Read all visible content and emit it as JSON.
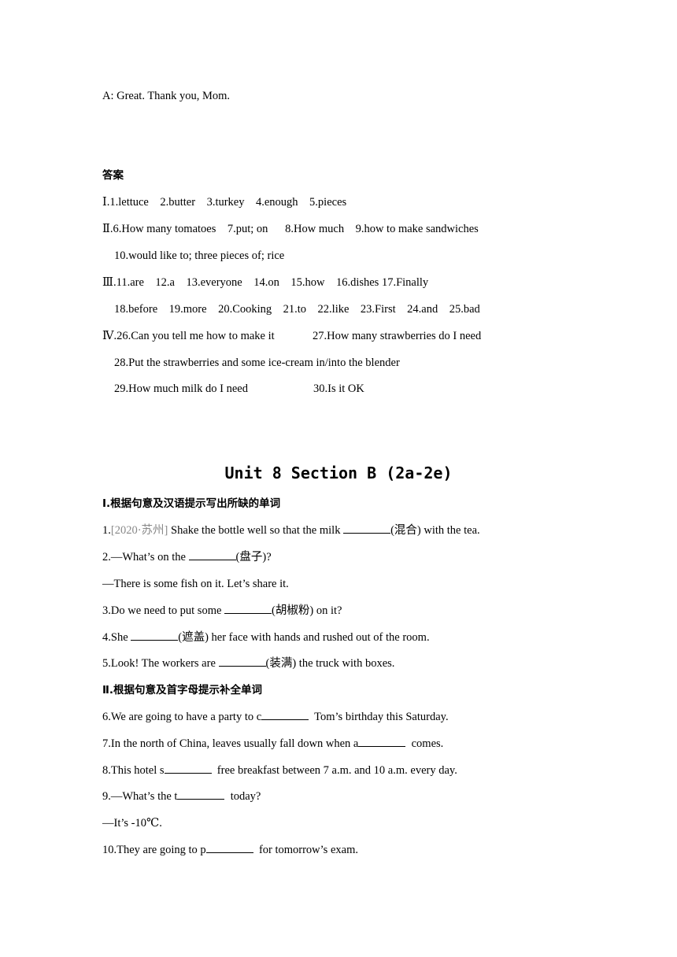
{
  "dialogue_end": "A: Great. Thank you, Mom.",
  "answers": {
    "heading": "答案",
    "part1": "Ⅰ.1.lettuce    2.butter    3.turkey    4.enough    5.pieces",
    "part2_line1": "Ⅱ.6.How many tomatoes    7.put; on      8.How much    9.how to make sandwiches",
    "part2_line2": "10.would like to; three pieces of; rice",
    "part3_line1": "Ⅲ.11.are    12.a    13.everyone    14.on    15.how    16.dishes 17.Finally",
    "part3_line2": "18.before    19.more    20.Cooking    21.to    22.like    23.First    24.and    25.bad",
    "part4_line1a": "Ⅳ.26.Can you tell me how to make it",
    "part4_line1b": "27.How many strawberries do I need",
    "part4_line2": "28.Put the strawberries and some ice-cream in/into the blender",
    "part4_line3a": "29.How much milk do I need",
    "part4_line3b": "30.Is it OK"
  },
  "unit_title": "Unit 8 Section B (2a-2e)",
  "section1": {
    "heading": "Ⅰ.根据句意及汉语提示写出所缺的单词",
    "q1": {
      "num": "1.",
      "source": "[2020·苏州]",
      "pre": " Shake the bottle well so that the milk ",
      "hint": "(混合)",
      "post": " with the tea."
    },
    "q2": {
      "pre": "2.—What’s on the ",
      "hint": "(盘子)",
      "post": "?"
    },
    "q2_reply": "—There is some fish on it. Let’s share it.",
    "q3": {
      "pre": "3.Do we need to put some ",
      "hint": "(胡椒粉)",
      "post": " on it?"
    },
    "q4": {
      "pre": "4.She ",
      "hint": "(遮盖)",
      "post": " her face with hands and rushed out of the room."
    },
    "q5": {
      "pre": "5.Look! The workers are ",
      "hint": "(装满)",
      "post": " the truck with boxes."
    }
  },
  "section2": {
    "heading": "Ⅱ.根据句意及首字母提示补全单词",
    "q6": {
      "pre": "6.We are going to have a party to c",
      "post": "  Tom’s birthday this Saturday."
    },
    "q7": {
      "pre": "7.In the north of China, leaves usually fall down when a",
      "post": "  comes."
    },
    "q8": {
      "pre": "8.This hotel s",
      "post": "  free breakfast between 7 a.m. and 10 a.m. every day."
    },
    "q9": {
      "pre": "9.—What’s the t",
      "post": "  today?"
    },
    "q9_reply": "—It’s -10℃.",
    "q10": {
      "pre": "10.They are going to p",
      "post": "  for tomorrow’s exam."
    }
  }
}
